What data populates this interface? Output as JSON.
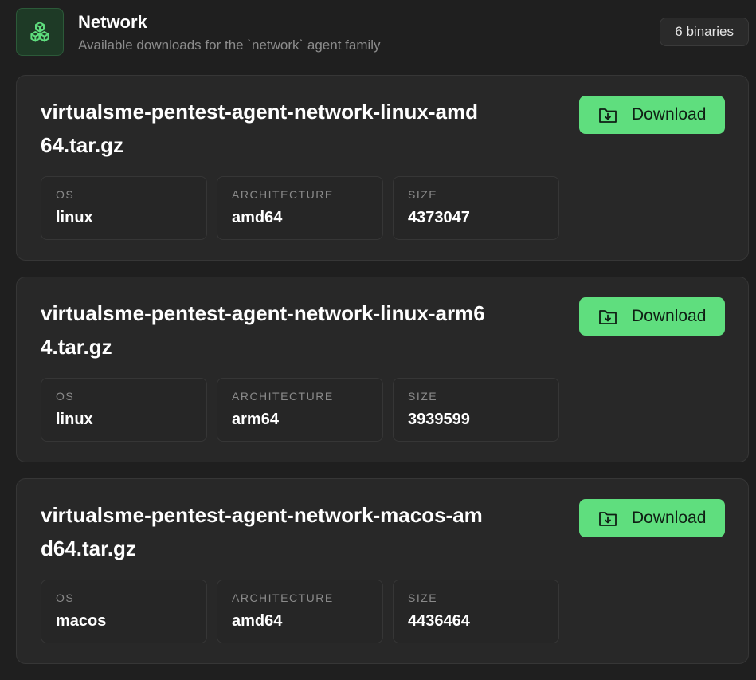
{
  "header": {
    "title": "Network",
    "subtitle": "Available downloads for the `network` agent family",
    "badge": "6 binaries",
    "icon": "cubes-icon",
    "accent_color": "#5fde7e"
  },
  "labels": {
    "os": "OS",
    "architecture": "ARCHITECTURE",
    "size": "SIZE",
    "download": "Download"
  },
  "binaries": [
    {
      "filename": "virtualsme-pentest-agent-network-linux-amd64.tar.gz",
      "os": "linux",
      "architecture": "amd64",
      "size": "4373047"
    },
    {
      "filename": "virtualsme-pentest-agent-network-linux-arm64.tar.gz",
      "os": "linux",
      "architecture": "arm64",
      "size": "3939599"
    },
    {
      "filename": "virtualsme-pentest-agent-network-macos-amd64.tar.gz",
      "os": "macos",
      "architecture": "amd64",
      "size": "4436464"
    }
  ]
}
